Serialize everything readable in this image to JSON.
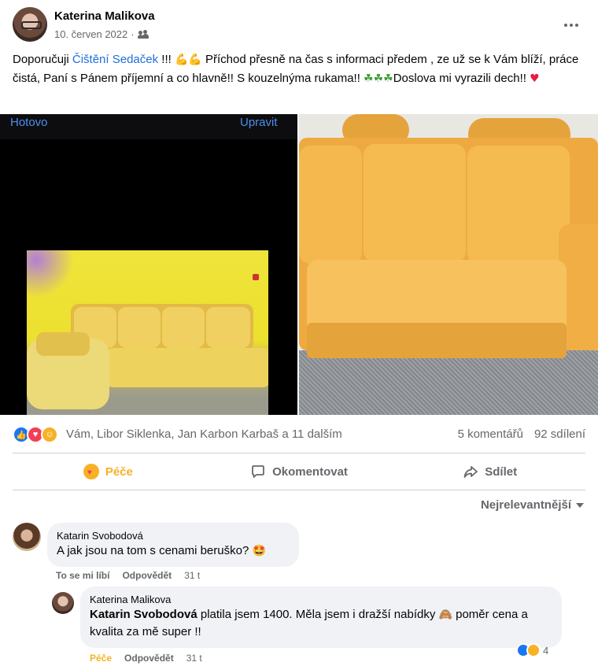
{
  "post": {
    "author": "Katerina Malikova",
    "date": "10. červen 2022",
    "separator": "·",
    "audience_icon": "friends-icon",
    "text_before_link": "Doporučuji ",
    "link_text": "Čištění Sedaček",
    "text_after_link": " !!! ",
    "arm_emojis": "💪💪",
    "text_middle": " Příchod přesně na čas s informaci předem , ze už se k Vám blíží, práce čistá, Paní s Pánem příjemní a co hlavně!! S kouzelnýma rukama!! ",
    "clovers": "☘☘☘",
    "text_end": "Doslova mi vyrazili dech!! ",
    "heart": "♥"
  },
  "photo_left": {
    "done_label": "Hotovo",
    "edit_label": "Upravit"
  },
  "reactions": {
    "names": "Vám, Libor Siklenka, Jan Karbon Karbaš a 11 dalším",
    "comments_count": "5 komentářů",
    "shares_count": "92 sdílení"
  },
  "actions": {
    "react_label": "Péče",
    "comment_label": "Okomentovat",
    "share_label": "Sdílet"
  },
  "sort_label": "Nejrelevantnější",
  "comments": [
    {
      "author": "Katarin Svobodová",
      "text": "A jak jsou na tom s cenami beruško? ",
      "emoji": "🤩",
      "like_label": "To se mi líbí",
      "reply_label": "Odpovědět",
      "time": "31 t"
    },
    {
      "author": "Katerina Malikova",
      "mention": "Katarin Svobodová",
      "text": " platila jsem 1400. Měla jsem i dražší nabídky ",
      "emoji": "🙈",
      "text2": " poměr cena a kvalita za mě super !!",
      "like_label": "Péče",
      "reply_label": "Odpovědět",
      "time": "31 t",
      "reaction_count": "4"
    }
  ],
  "colors": {
    "link": "#216fdb",
    "care": "#f7b125",
    "like": "#1877f2",
    "love": "#f33e58",
    "muted": "#65676b"
  }
}
